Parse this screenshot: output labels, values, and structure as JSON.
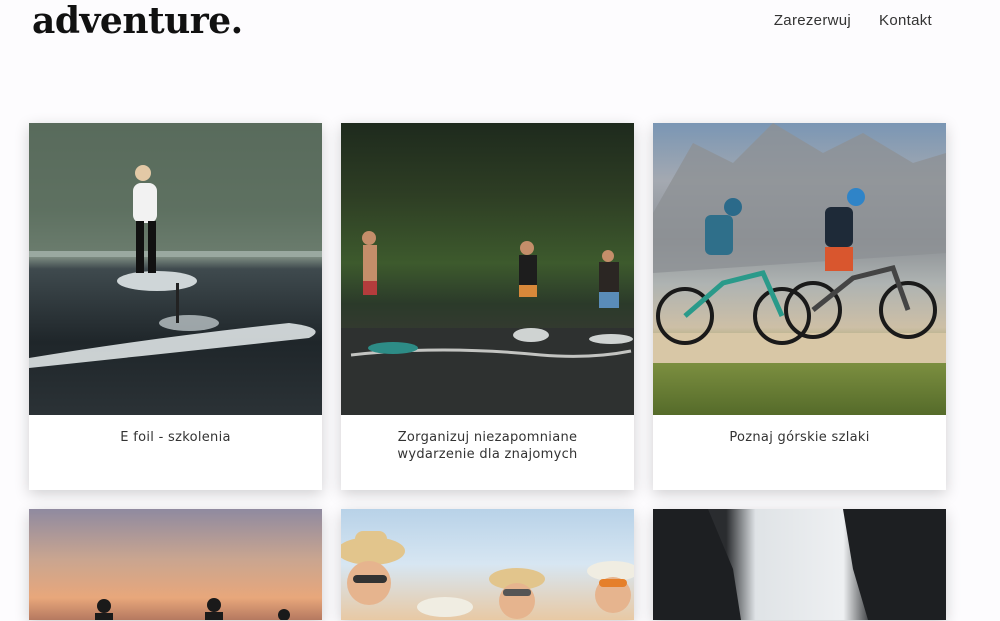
{
  "brand": {
    "logo": "adventure."
  },
  "nav": {
    "items": [
      "Zarezerwuj",
      "Kontakt"
    ]
  },
  "cards": [
    {
      "caption": "E foil - szkolenia",
      "image": "efoil-lake-photo"
    },
    {
      "caption": "Zorganizuj niezapomniane wydarzenie dla znajomych",
      "image": "group-efoil-photo"
    },
    {
      "caption": "Poznaj górskie szlaki",
      "image": "mountain-bikers-photo"
    },
    {
      "caption": "",
      "image": "sunset-group-photo"
    },
    {
      "caption": "",
      "image": "friends-hats-photo"
    },
    {
      "caption": "",
      "image": "sea-cliffs-photo"
    }
  ]
}
